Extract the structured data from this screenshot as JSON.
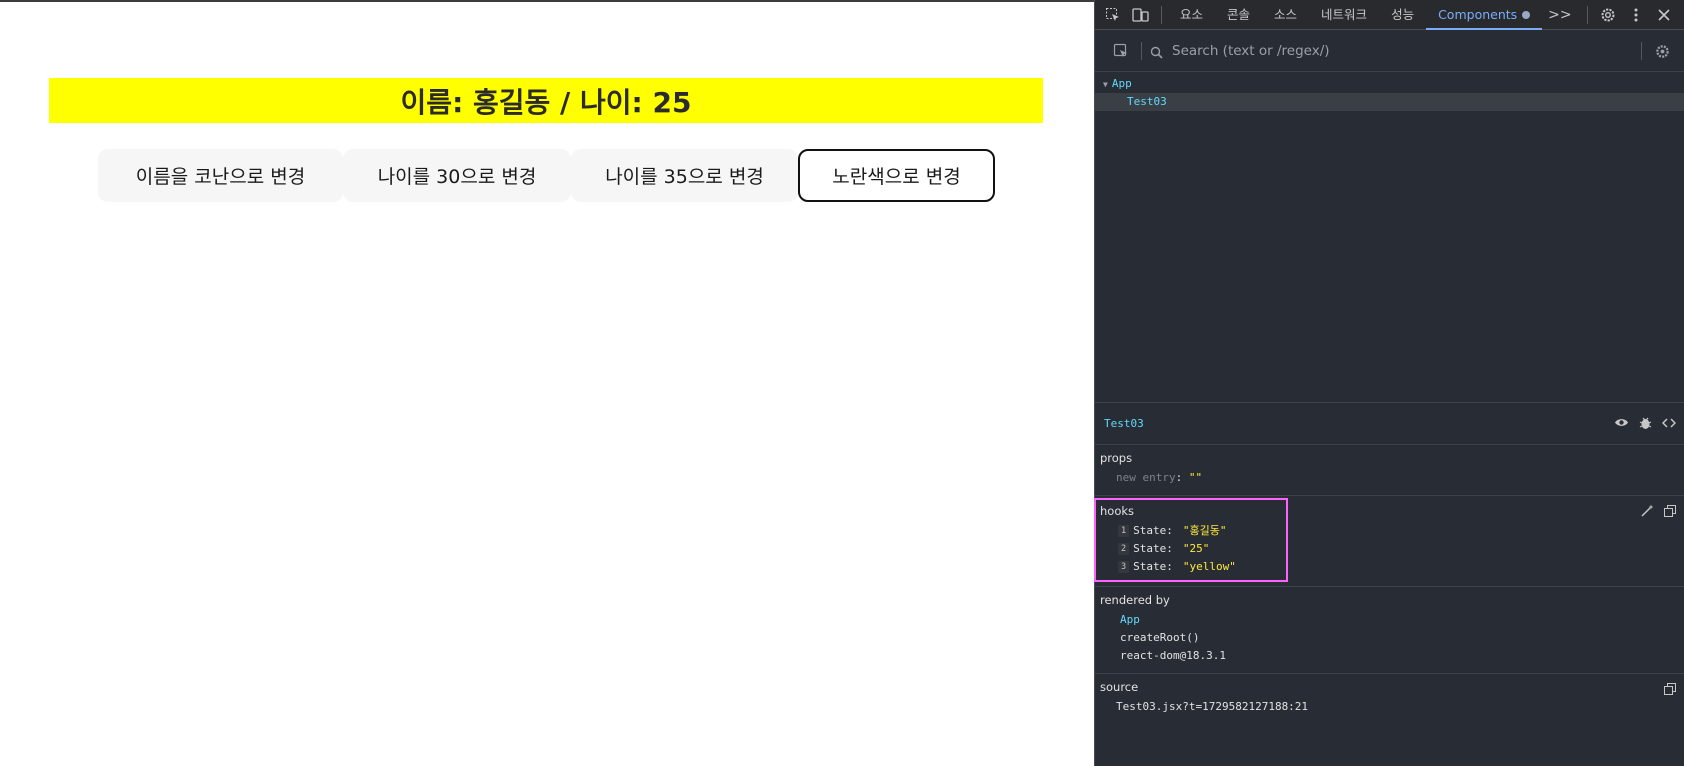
{
  "page": {
    "heading": "이름: 홍길동 / 나이: 25",
    "banner_color": "#ffff00",
    "buttons": [
      "이름을 코난으로 변경",
      "나이를 30으로 변경",
      "나이를 35으로 변경",
      "노란색으로 변경"
    ]
  },
  "devtools": {
    "tabs": [
      "요소",
      "콘솔",
      "소스",
      "네트워크",
      "성능",
      "Components"
    ],
    "active_tab": "Components",
    "more_tabs": ">>",
    "search_placeholder": "Search (text or /regex/)",
    "tree": [
      {
        "label": "App"
      },
      {
        "label": "Test03"
      }
    ],
    "selected_component": "Test03",
    "props": {
      "title": "props",
      "new_entry_key": "new entry",
      "colon": ":",
      "new_entry_value": "\"\""
    },
    "hooks": {
      "title": "hooks",
      "items": [
        {
          "index": "1",
          "key": "State:",
          "value": "\"홍길동\""
        },
        {
          "index": "2",
          "key": "State:",
          "value": "\"25\""
        },
        {
          "index": "3",
          "key": "State:",
          "value": "\"yellow\""
        }
      ]
    },
    "rendered_by": {
      "title": "rendered by",
      "items": [
        "App",
        "createRoot()",
        "react-dom@18.3.1"
      ]
    },
    "source": {
      "title": "source",
      "file": "Test03.jsx?t=1729582127188:21"
    }
  }
}
